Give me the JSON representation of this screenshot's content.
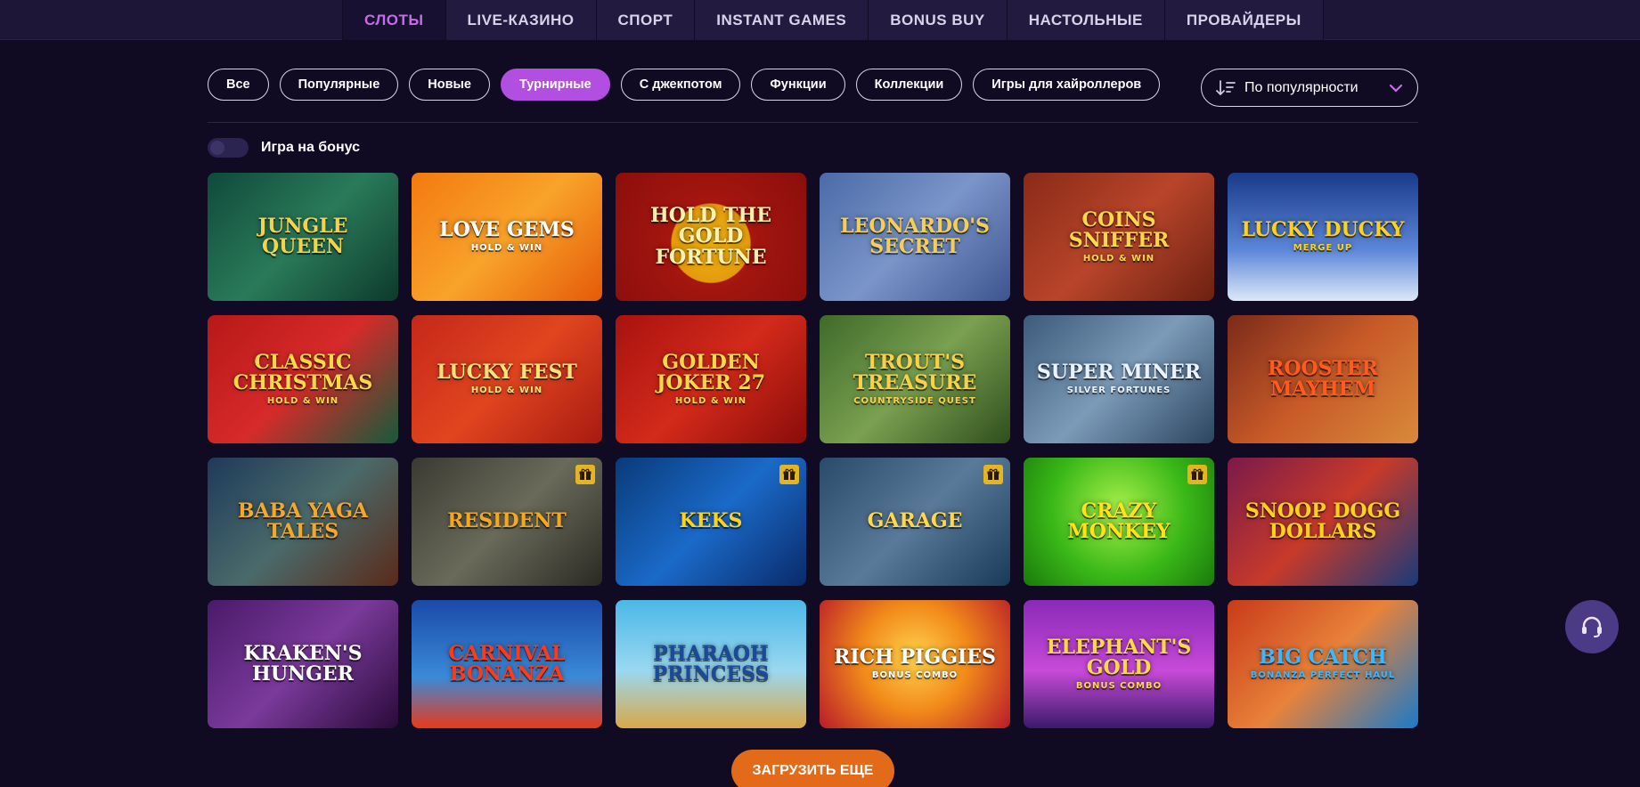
{
  "nav": {
    "tabs": [
      {
        "label": "СЛОТЫ",
        "active": true
      },
      {
        "label": "LIVE-КАЗИНО",
        "active": false
      },
      {
        "label": "СПОРТ",
        "active": false
      },
      {
        "label": "INSTANT GAMES",
        "active": false
      },
      {
        "label": "BONUS BUY",
        "active": false
      },
      {
        "label": "НАСТОЛЬНЫЕ",
        "active": false
      },
      {
        "label": "ПРОВАЙДЕРЫ",
        "active": false
      }
    ]
  },
  "filters": {
    "chips": [
      {
        "label": "Все",
        "active": false
      },
      {
        "label": "Популярные",
        "active": false
      },
      {
        "label": "Новые",
        "active": false
      },
      {
        "label": "Турнирные",
        "active": true
      },
      {
        "label": "С джекпотом",
        "active": false
      },
      {
        "label": "Функции",
        "active": false
      },
      {
        "label": "Коллекции",
        "active": false
      },
      {
        "label": "Игры для хайроллеров",
        "active": false
      }
    ],
    "sort_label": "По популярности",
    "sort_icon": "sort-descending-icon",
    "bonus_toggle_label": "Игра на бонус",
    "bonus_toggle_on": false
  },
  "games": [
    {
      "title": "Jungle Queen",
      "sub": "",
      "bg": "linear-gradient(135deg,#0f4a3a,#2a7a5a 50%,#0d3a2c)",
      "color": "#f2d44a",
      "gift": false
    },
    {
      "title": "Love Gems",
      "sub": "HOLD & WIN",
      "bg": "linear-gradient(135deg,#f27a10,#f9a32a 50%,#e55a08)",
      "color": "#ffffff",
      "gift": false
    },
    {
      "title": "Hold the Gold Fortune",
      "sub": "",
      "bg": "radial-gradient(circle at 50% 55%,#f1b515 0,#e49a0c 33%,#a5160f 34%,#8a0e0c 100%)",
      "color": "#fff2b0",
      "gift": false
    },
    {
      "title": "Leonardo's Secret",
      "sub": "",
      "bg": "linear-gradient(135deg,#4b6aa8,#7a95c8 50%,#3d5590)",
      "color": "#f3cf5a",
      "gift": false
    },
    {
      "title": "Coins Sniffer",
      "sub": "HOLD & WIN",
      "bg": "linear-gradient(135deg,#8a2a18,#b8452a 50%,#6d2012)",
      "color": "#ffd84a",
      "gift": false
    },
    {
      "title": "Lucky Ducky",
      "sub": "MERGE UP",
      "bg": "linear-gradient(180deg,#1a3a8a,#5c86d8 60%,#dce8f8)",
      "color": "#ffd21a",
      "gift": false
    },
    {
      "title": "Classic Christmas",
      "sub": "HOLD & WIN",
      "bg": "linear-gradient(135deg,#b81818,#d72a2a 50%,#155a3a)",
      "color": "#ffd84a",
      "gift": false
    },
    {
      "title": "Lucky Fest",
      "sub": "HOLD & WIN",
      "bg": "linear-gradient(135deg,#c4281a,#e0451f 50%,#a81a10)",
      "color": "#ffe27a",
      "gift": false
    },
    {
      "title": "Golden Joker 27",
      "sub": "HOLD & WIN",
      "bg": "linear-gradient(135deg,#a8120f,#d32a1a 50%,#8a0c0a)",
      "color": "#ffd84a",
      "gift": false
    },
    {
      "title": "Trout's Treasure",
      "sub": "COUNTRYSIDE QUEST",
      "bg": "linear-gradient(135deg,#3e6a2a,#7aa050 50%,#2f4e1e)",
      "color": "#f7d14a",
      "gift": false
    },
    {
      "title": "Super Miner",
      "sub": "SILVER FORTUNES",
      "bg": "linear-gradient(135deg,#3c5a7a,#7b9bb8 50%,#2c4460)",
      "color": "#e9f2ff",
      "gift": false
    },
    {
      "title": "Rooster Mayhem",
      "sub": "",
      "bg": "linear-gradient(135deg,#7a2a1a,#c85a28 50%,#d88a3a)",
      "color": "#ff5a20",
      "gift": false
    },
    {
      "title": "Baba Yaga Tales",
      "sub": "",
      "bg": "linear-gradient(135deg,#1e3a5a,#4a6a6a 50%,#5a2a1a)",
      "color": "#f3a82a",
      "gift": false
    },
    {
      "title": "Resident",
      "sub": "",
      "bg": "linear-gradient(135deg,#3a3a32,#6a6a5a 50%,#2a2a24)",
      "color": "#f7a81a",
      "gift": true
    },
    {
      "title": "Keks",
      "sub": "",
      "bg": "linear-gradient(135deg,#0a3a7a,#1a6ac8 50%,#0a2a6a)",
      "color": "#ffd21a",
      "gift": true
    },
    {
      "title": "Garage",
      "sub": "",
      "bg": "linear-gradient(135deg,#2a4a6a,#5a7a9a 50%,#1a3a5a)",
      "color": "#ffd84a",
      "gift": true
    },
    {
      "title": "Crazy Monkey",
      "sub": "",
      "bg": "radial-gradient(circle at 50% 40%,#a8f04a,#3ab818 55%,#1a7a0c)",
      "color": "#ffe21a",
      "gift": true
    },
    {
      "title": "Snoop Dogg Dollars",
      "sub": "",
      "bg": "linear-gradient(135deg,#7a1a4a,#c83a2a 50%,#1a3a7a)",
      "color": "#ffd21a",
      "gift": false
    },
    {
      "title": "Kraken's Hunger",
      "sub": "",
      "bg": "linear-gradient(135deg,#4a1a6a,#7a3a9a 50%,#2a0a3a)",
      "color": "#ffffff",
      "gift": false
    },
    {
      "title": "Carnival Bonanza",
      "sub": "",
      "bg": "linear-gradient(180deg,#1a4aa8,#3a8ad8 60%,#e83a1a)",
      "color": "#ff3a1a",
      "gift": false
    },
    {
      "title": "Pharaoh Princess",
      "sub": "",
      "bg": "linear-gradient(180deg,#4ab8e8,#9ad8f0 55%,#d8a848)",
      "color": "#1a4a9a",
      "gift": false
    },
    {
      "title": "Rich Piggies",
      "sub": "BONUS COMBO",
      "bg": "radial-gradient(circle at 50% 45%,#ffd24a,#f28a1a 45%,#b81a2a)",
      "color": "#ffffff",
      "gift": false
    },
    {
      "title": "Elephant's Gold",
      "sub": "BONUS COMBO",
      "bg": "linear-gradient(180deg,#8a2ab8,#c84ad8 55%,#3a1a6a)",
      "color": "#ffd84a",
      "gift": false
    },
    {
      "title": "Big Catch",
      "sub": "BONANZA PERFECT HAUL",
      "bg": "linear-gradient(135deg,#c83a1a,#e8823a 50%,#1a7ac8)",
      "color": "#3ab8ff",
      "gift": false
    }
  ],
  "load_more_label": "ЗАГРУЗИТЬ ЕЩЕ",
  "support_icon": "headset-icon"
}
